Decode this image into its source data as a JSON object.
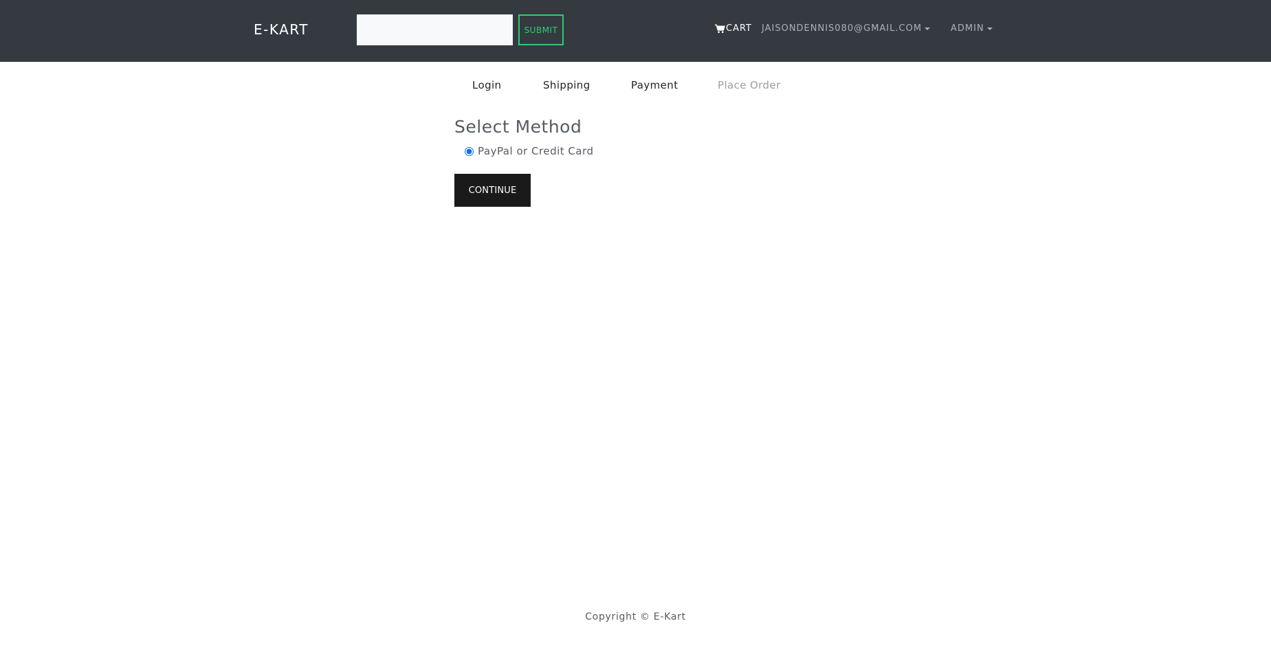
{
  "header": {
    "brand": "E-KART",
    "search": {
      "value": "",
      "placeholder": ""
    },
    "submit_label": "SUBMIT",
    "cart_label": "CART",
    "user_label": "JAISONDENNIS080@GMAIL.COM",
    "admin_label": "ADMIN"
  },
  "steps": {
    "login": "Login",
    "shipping": "Shipping",
    "payment": "Payment",
    "place_order": "Place Order"
  },
  "main": {
    "title": "Select Method",
    "payment_option": "PayPal or Credit Card",
    "payment_option_checked": true,
    "continue_label": "CONTINUE"
  },
  "footer": {
    "copyright": "Copyright © E-Kart"
  },
  "colors": {
    "navbar": "#343a40",
    "submit_accent": "#2ecc71",
    "continue_bg": "#1a1a1a",
    "radio_accent": "#0d6efd"
  },
  "icons": {
    "cart": "shopping-cart-icon"
  }
}
